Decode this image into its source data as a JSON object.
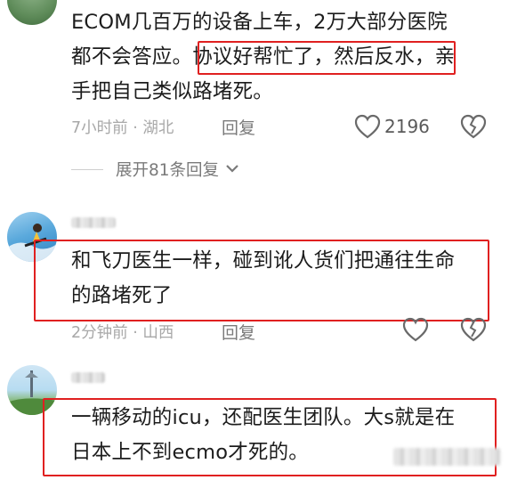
{
  "comments": [
    {
      "text_line1": "ECOM几百万的设备上车，2万大部分医院",
      "text_line2_before": "都不会答应。",
      "text_line2_boxed": "协议好帮忙了，然后反水",
      "text_line2_after": "，亲",
      "text_line3": "手把自己类似路堵死。",
      "meta": "7小时前 · 湖北",
      "reply_label": "回复",
      "likes": "2196",
      "expand_label": "展开81条回复"
    },
    {
      "text_line1": "和飞刀医生一样，碰到讹人货们把通往生命",
      "text_line2": "的路堵死了",
      "meta": "2分钟前 · 山西",
      "reply_label": "回复"
    },
    {
      "text_line1": "一辆移动的icu，还配医生团队。大s就是在",
      "text_line2": "日本上不到ecmo才死的。"
    }
  ],
  "colors": {
    "highlight_box": "#e02020",
    "meta_text": "#a8a8a8",
    "secondary_text": "#7a7a7a"
  },
  "icons": [
    "heart-outline-icon",
    "broken-heart-icon",
    "chevron-down-icon"
  ]
}
